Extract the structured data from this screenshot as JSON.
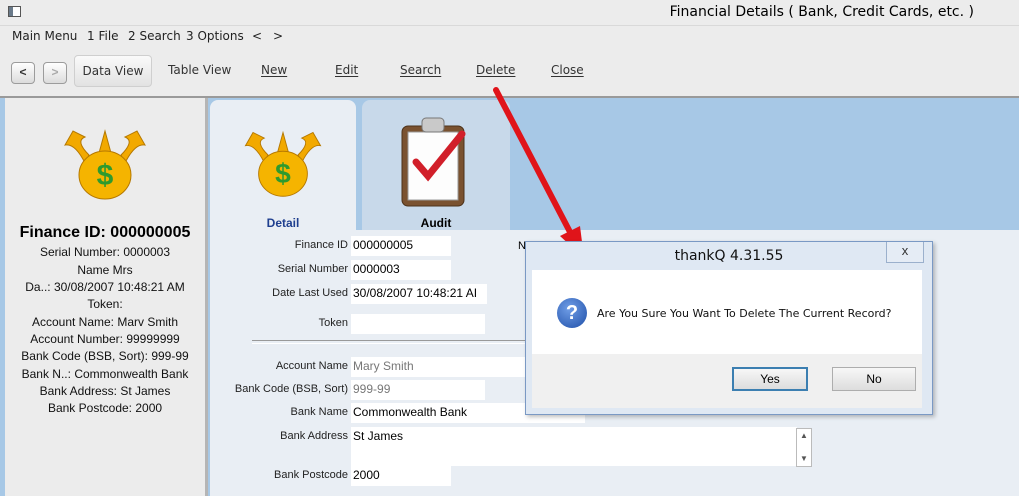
{
  "window": {
    "title": "Financial Details ( Bank, Credit Cards, etc. )"
  },
  "menu": {
    "items": [
      "Main Menu",
      "1 File",
      "2 Search",
      "3 Options",
      "<",
      ">"
    ]
  },
  "toolbar": {
    "back": "<",
    "forward": ">",
    "data_view": "Data View",
    "table_view": "Table View",
    "new": "New",
    "edit": "Edit",
    "search": "Search",
    "delete": "Delete",
    "close": "Close"
  },
  "summary": {
    "finance_id": "Finance ID: 000000005",
    "serial": "Serial Number: 0000003",
    "name": "Name Mrs",
    "date": "Da..: 30/08/2007 10:48:21 AM",
    "token": "Token:",
    "account_name": "Account Name: Marv Smith",
    "account_number": "Account Number: 99999999",
    "bank_code": "Bank Code (BSB, Sort): 999-99",
    "bank_name": "Bank N..: Commonwealth Bank",
    "bank_address": "Bank Address: St James",
    "bank_postcode": "Bank Postcode: 2000"
  },
  "tabs": {
    "detail": "Detail",
    "audit": "Audit"
  },
  "form": {
    "finance_id": {
      "label": "Finance ID",
      "value": "000000005"
    },
    "serial_number": {
      "label": "Serial Number",
      "value": "0000003"
    },
    "date_last_used": {
      "label": "Date Last Used",
      "value": "30/08/2007 10:48:21 AI"
    },
    "token": {
      "label": "Token",
      "value": ""
    },
    "account_name": {
      "label": "Account Name",
      "value": "Mary Smith"
    },
    "bank_code": {
      "label": "Bank Code (BSB, Sort)",
      "value": "999-99"
    },
    "bank_name": {
      "label": "Bank Name",
      "value": "Commonwealth Bank"
    },
    "bank_address": {
      "label": "Bank Address",
      "value": "St James"
    },
    "bank_postcode": {
      "label": "Bank Postcode",
      "value": "2000"
    },
    "partial_n": "N"
  },
  "dialog": {
    "title": "thankQ 4.31.55",
    "close": "x",
    "message": "Are You Sure You Want To Delete The Current Record?",
    "yes": "Yes",
    "no": "No"
  },
  "colors": {
    "annotation_arrow": "#e0141a",
    "tab_active": "#e9eef4",
    "background": "#a7c8e6"
  },
  "icons": [
    "app-icon",
    "money-bag-icon",
    "clipboard-check-icon",
    "question-icon",
    "scroll-up-icon",
    "scroll-down-icon"
  ]
}
